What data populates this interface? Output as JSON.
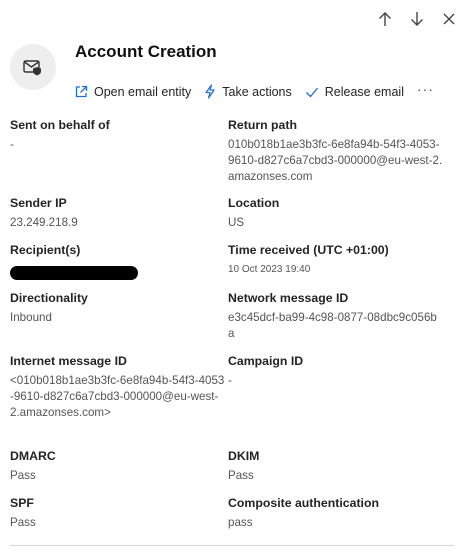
{
  "header": {
    "title": "Account Creation",
    "icons": {
      "up": "arrow-up-icon",
      "down": "arrow-down-icon",
      "avatar": "email-envelope-icon"
    }
  },
  "actions": {
    "open_email": "Open email entity",
    "take_actions": "Take actions",
    "release_email": "Release email",
    "more": "···"
  },
  "details": {
    "sent_on_behalf": {
      "label": "Sent on behalf of",
      "value": "-"
    },
    "return_path": {
      "label": "Return path",
      "value": "010b018b1ae3b3fc-6e8fa94b-54f3-4053-9610-d827c6a7cbd3-000000@eu-west-2.amazonses.com"
    },
    "sender_ip": {
      "label": "Sender IP",
      "value": "23.249.218.9"
    },
    "location": {
      "label": "Location",
      "value": "US"
    },
    "recipients": {
      "label": "Recipient(s)"
    },
    "time_received": {
      "label": "Time received (UTC +01:00)",
      "value": "10 Oct 2023 19:40"
    },
    "directionality": {
      "label": "Directionality",
      "value": "Inbound"
    },
    "network_message_id": {
      "label": "Network message ID",
      "value": "e3c45dcf-ba99-4c98-0877-08dbc9c056ba"
    },
    "internet_message_id": {
      "label": "Internet message ID",
      "value": "<010b018b1ae3b3fc-6e8fa94b-54f3-4053-9610-d827c6a7cbd3-000000@eu-west-2.amazonses.com>"
    },
    "campaign_id": {
      "label": "Campaign ID",
      "value": "-"
    },
    "dmarc": {
      "label": "DMARC",
      "value": "Pass"
    },
    "dkim": {
      "label": "DKIM",
      "value": "Pass"
    },
    "spf": {
      "label": "SPF",
      "value": "Pass"
    },
    "composite_auth": {
      "label": "Composite authentication",
      "value": "pass"
    }
  }
}
